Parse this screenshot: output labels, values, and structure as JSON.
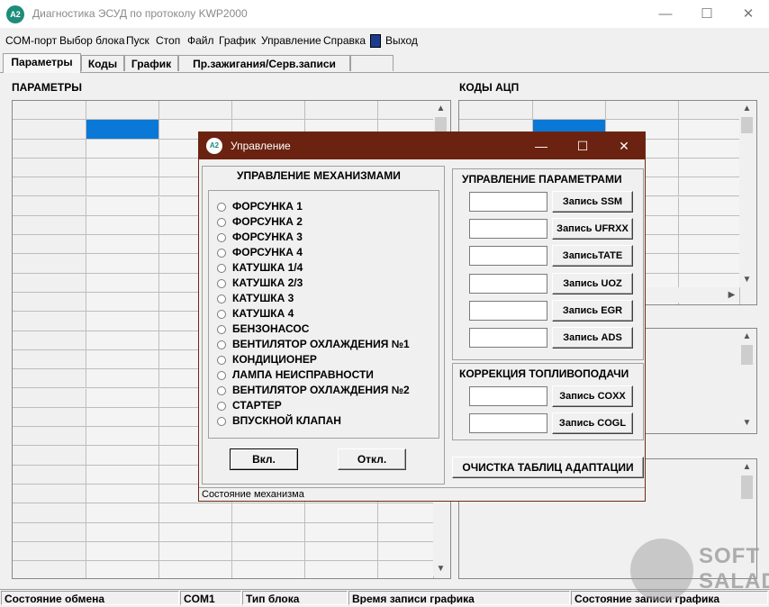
{
  "window": {
    "logo_text": "A2",
    "title": "Диагностика ЭСУД по протоколу KWP2000",
    "minimize_glyph": "—",
    "maximize_glyph": "☐",
    "close_glyph": "✕"
  },
  "menu": {
    "items": [
      "COM-порт",
      "Выбор блока",
      "Пуск",
      "Стоп",
      "Файл",
      "График",
      "Управление",
      "Справка"
    ],
    "exit_label": "Выход"
  },
  "tabs": [
    "Параметры",
    "Коды",
    "График",
    "Пр.зажигания/Серв.записи"
  ],
  "left_panel": {
    "title": "ПАРАМЕТРЫ"
  },
  "right_panel": {
    "title": "КОДЫ АЦП"
  },
  "scroll_glyphs": {
    "up": "▲",
    "down": "▼",
    "left": "◀",
    "right": "▶"
  },
  "statusbar": {
    "panels": [
      "Состояние обмена",
      "COM1",
      "Тип блока",
      "Время записи графика",
      "Состояние записи графика"
    ]
  },
  "dialog": {
    "logo_text": "A2",
    "title": "Управление",
    "minimize_glyph": "—",
    "maximize_glyph": "☐",
    "close_glyph": "✕",
    "mechanisms": {
      "title": "УПРАВЛЕНИЕ МЕХАНИЗМАМИ",
      "items": [
        "ФОРСУНКА 1",
        "ФОРСУНКА 2",
        "ФОРСУНКА 3",
        "ФОРСУНКА 4",
        "КАТУШКА 1/4",
        "КАТУШКА 2/3",
        "КАТУШКА 3",
        "КАТУШКА 4",
        "БЕНЗОНАСОС",
        "ВЕНТИЛЯТОР ОХЛАЖДЕНИЯ №1",
        "КОНДИЦИОНЕР",
        "ЛАМПА НЕИСПРАВНОСТИ",
        "ВЕНТИЛЯТОР ОХЛАЖДЕНИЯ №2",
        "СТАРТЕР",
        "ВПУСКНОЙ КЛАПАН"
      ],
      "on_label": "Вкл.",
      "off_label": "Откл."
    },
    "params": {
      "title": "УПРАВЛЕНИЕ ПАРАМЕТРАМИ",
      "buttons": [
        "Запись SSM",
        "Запись UFRXX",
        "ЗаписьTATE",
        "Запись UOZ",
        "Запись EGR",
        "Запись ADS"
      ]
    },
    "fuel": {
      "title": "КОРРЕКЦИЯ ТОПЛИВОПОДАЧИ",
      "buttons": [
        "Запись COXX",
        "Запись COGL"
      ]
    },
    "clear_label": "ОЧИСТКА ТАБЛИЦ АДАПТАЦИИ",
    "status": "Состояние механизма"
  },
  "watermark": {
    "line1": "SOFT",
    "line2": "SALAD"
  },
  "colors": {
    "dialog_title_bg": "#6b2210",
    "grid_selection": "#0a78d7",
    "logo": "#1e8c7a"
  }
}
